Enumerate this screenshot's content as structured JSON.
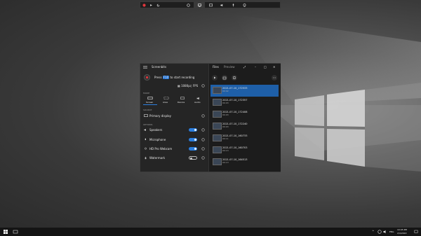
{
  "toolbar": {
    "buttons": [
      "record-icon",
      "pause-icon",
      "stop-icon",
      "screenshot-icon",
      "monitor-icon",
      "window-icon",
      "speaker-icon",
      "microphone-icon",
      "webcam-icon"
    ]
  },
  "window": {
    "title": "Screenbits",
    "tabs": [
      "Files",
      "Preview"
    ],
    "press_label": "Press",
    "hotkey": "F10",
    "start_label": "to start recording",
    "quality": "1080p",
    "fps": "FPS",
    "mode_header": "MODE",
    "modes": [
      "Screen",
      "Area",
      "Device",
      "Audio"
    ],
    "source_header": "SOURCE",
    "source_value": "Primary display",
    "options_header": "OPTIONS",
    "options": [
      {
        "label": "Speakers",
        "on": true
      },
      {
        "label": "Microphone",
        "on": true
      },
      {
        "label": "HD Pro Webcam",
        "on": true
      },
      {
        "label": "Watermark",
        "on": false
      }
    ],
    "files": [
      {
        "name": "2021-07-10_172533",
        "size": "00:02",
        "selected": true
      },
      {
        "name": "2021-07-10_172357",
        "size": "00:03",
        "selected": false
      },
      {
        "name": "2021-07-10_172408",
        "size": "00:03",
        "selected": false
      },
      {
        "name": "2021-07-10_172240",
        "size": "00:03",
        "selected": false
      },
      {
        "name": "2021-07-10_160733",
        "size": "00:11",
        "selected": false
      },
      {
        "name": "2021-07-10_160703",
        "size": "00:13",
        "selected": false
      },
      {
        "name": "2021-07-10_164513",
        "size": "00:13",
        "selected": false
      }
    ]
  },
  "taskbar": {
    "lang": "ENG",
    "time": "10:05 PM",
    "date": "2/4/2022"
  },
  "colors": {
    "accent": "#2b7ddc",
    "record": "#e0363c",
    "selected": "#1e5fa8"
  }
}
